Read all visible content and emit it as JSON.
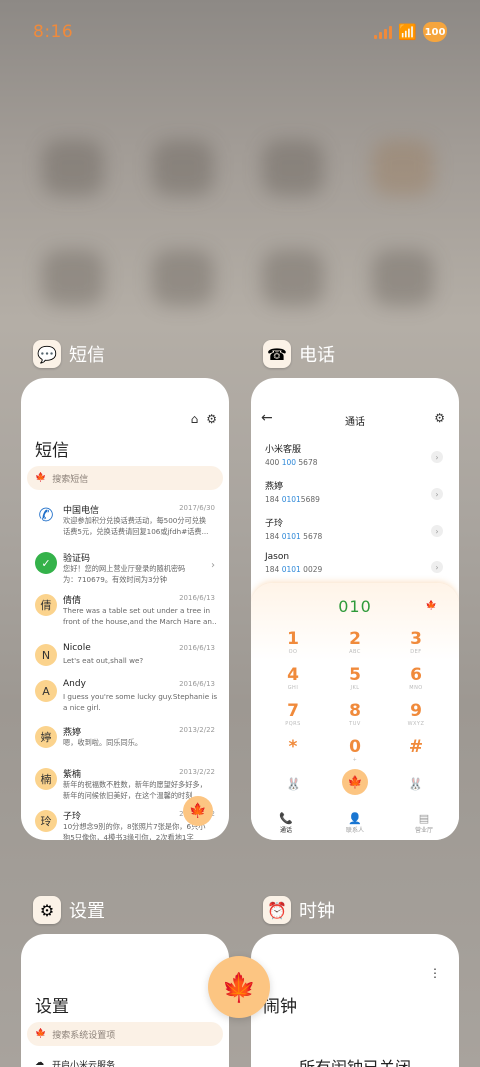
{
  "status_bar": {
    "time": "8:16",
    "battery": "100"
  },
  "apps": {
    "sms": {
      "name": "短信",
      "title": "短信",
      "search_placeholder": "搜索短信",
      "messages": [
        {
          "avatar": "✆",
          "name": "中国电信",
          "date": "2017/6/30",
          "text": "欢迎参加积分兑换话费活动，每500分可兑换\n话费5元，兑换话费请回复106或jfdh#话费..."
        },
        {
          "avatar": "✓",
          "name": "验证码",
          "date": "",
          "text": "您好！您的网上营业厅登录的随机密码\n为：710679。有效时间为3分钟"
        },
        {
          "avatar": "倩",
          "name": "倩倩",
          "date": "2016/6/13",
          "text": "There was a table set out under a tree in\nfront of the house,and the March Hare an..."
        },
        {
          "avatar": "N",
          "name": "Nicole",
          "date": "2016/6/13",
          "text": "Let's eat out,shall we?"
        },
        {
          "avatar": "A",
          "name": "Andy",
          "date": "2016/6/13",
          "text": "I guess you're some lucky guy.Stephanie is\na nice girl."
        },
        {
          "avatar": "婷",
          "name": "燕婷",
          "date": "2013/2/22",
          "text": "嗯，收到啦。同乐同乐。"
        },
        {
          "avatar": "楠",
          "name": "紫楠",
          "date": "2013/2/22",
          "text": "新年的祝福数不胜数，新年的愿望好多好多，\n新年的问候依旧美好，在这个温馨的时刻..."
        },
        {
          "avatar": "玲",
          "name": "子玲",
          "date": "2013/2/22",
          "text": "10分想念9別的你，8张照片7张是你，6只小\n狗5只像你，4模书3缘引你，2次看地1字"
        }
      ]
    },
    "phone": {
      "name": "电话",
      "title": "通话",
      "dialed": "010",
      "contacts": [
        {
          "name": "小米客服",
          "pre": "400 ",
          "hl": "100",
          "post": " 5678"
        },
        {
          "name": "燕婷",
          "pre": "184 ",
          "hl": "0101",
          "post": "5689"
        },
        {
          "name": "子玲",
          "pre": "184 ",
          "hl": "0101",
          "post": " 5678"
        },
        {
          "name": "Jason",
          "pre": "184 ",
          "hl": "0101",
          "post": " 0029"
        }
      ],
      "keys": [
        {
          "k": "1",
          "s": "OO"
        },
        {
          "k": "2",
          "s": "ABC"
        },
        {
          "k": "3",
          "s": "DEF"
        },
        {
          "k": "4",
          "s": "GHI"
        },
        {
          "k": "5",
          "s": "JKL"
        },
        {
          "k": "6",
          "s": "MNO"
        },
        {
          "k": "7",
          "s": "PQRS"
        },
        {
          "k": "8",
          "s": "TUV"
        },
        {
          "k": "9",
          "s": "WXYZ"
        },
        {
          "k": "*",
          "s": ""
        },
        {
          "k": "0",
          "s": "+"
        },
        {
          "k": "#",
          "s": ""
        }
      ],
      "tabs": [
        "通话",
        "联系人",
        "营业厅"
      ]
    },
    "settings": {
      "name": "设置",
      "title": "设置",
      "search_placeholder": "搜索系统设置项",
      "first_item": "开启小米云服务"
    },
    "clock": {
      "name": "时钟",
      "title": "闹钟",
      "status": "所有闹钟已关闭"
    }
  },
  "colors": {
    "accent": "#f08a3b",
    "link": "#2e88d8",
    "fab": "#fcc582"
  }
}
